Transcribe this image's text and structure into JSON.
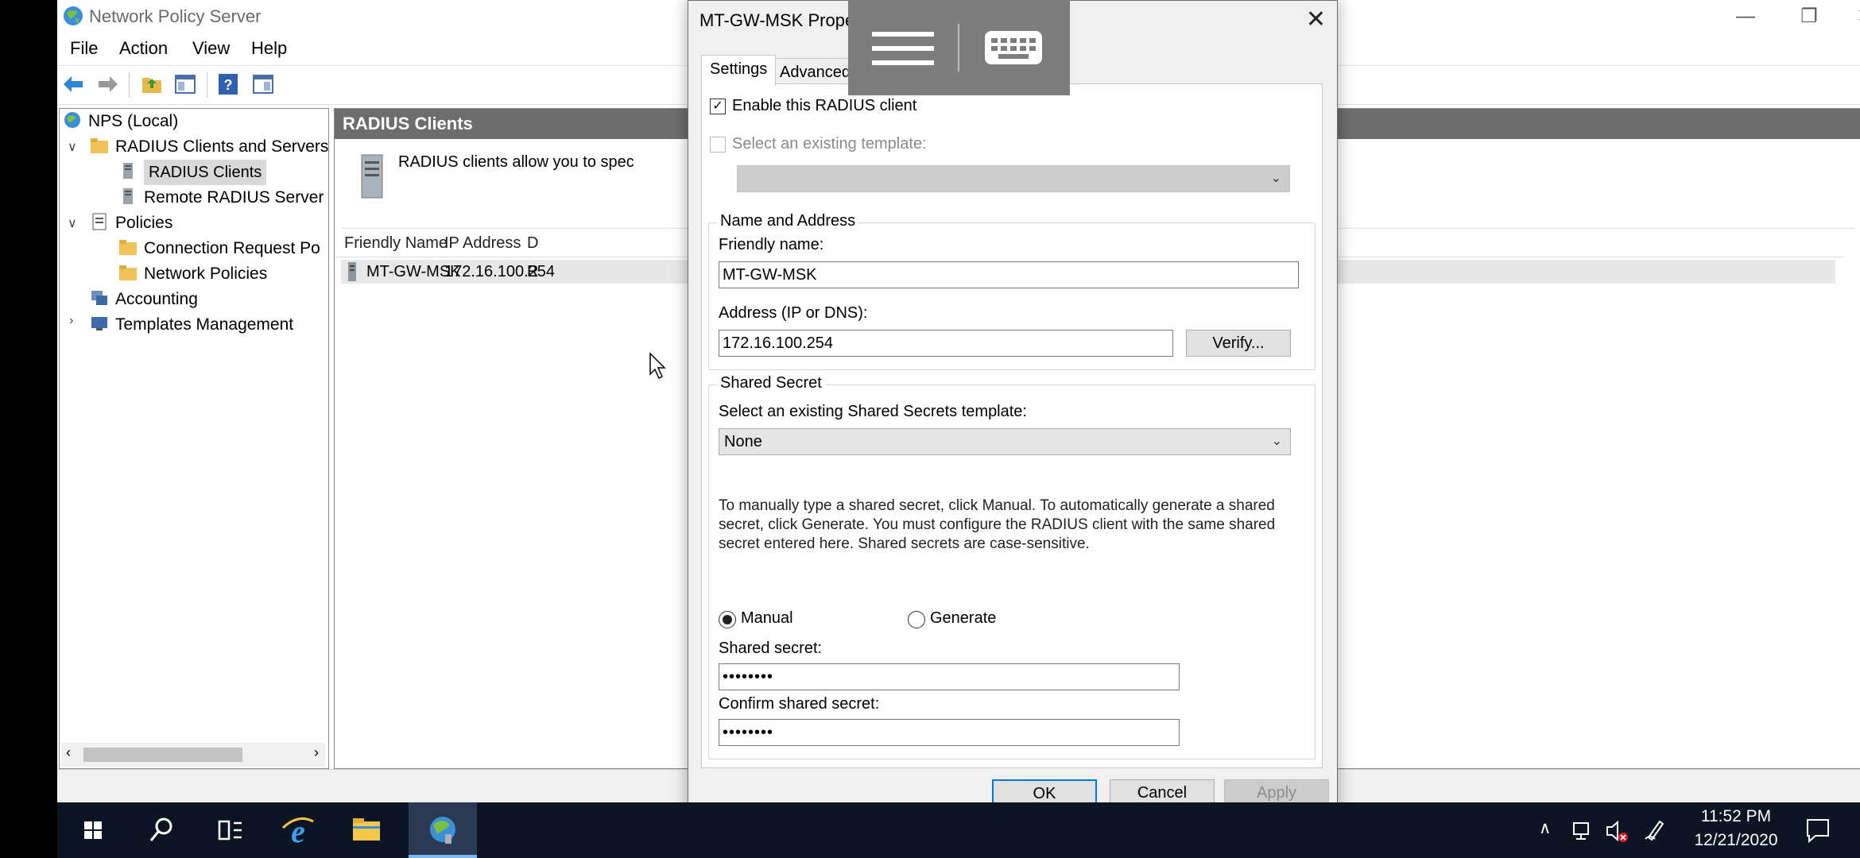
{
  "main_window": {
    "title": "Network Policy Server",
    "menu": [
      "File",
      "Action",
      "View",
      "Help"
    ]
  },
  "tree": {
    "items": [
      {
        "label": "NPS (Local)"
      },
      {
        "label": "RADIUS Clients and Servers"
      },
      {
        "label": "RADIUS Clients"
      },
      {
        "label": "Remote RADIUS Server"
      },
      {
        "label": "Policies"
      },
      {
        "label": "Connection Request Po"
      },
      {
        "label": "Network Policies"
      },
      {
        "label": "Accounting"
      },
      {
        "label": "Templates Management"
      }
    ]
  },
  "content": {
    "header": "RADIUS Clients",
    "description": "RADIUS clients allow you to spec",
    "columns": [
      "Friendly Name",
      "IP Address",
      "D"
    ],
    "rows": [
      {
        "name": "MT-GW-MSK",
        "ip": "172.16.100.254",
        "d": "R"
      }
    ]
  },
  "dialog": {
    "title": "MT-GW-MSK Properties",
    "tabs": [
      "Settings",
      "Advanced"
    ],
    "enable_label": "Enable this RADIUS client",
    "template_label": "Select an existing template:",
    "group_name_address": "Name and Address",
    "friendly_label": "Friendly name:",
    "friendly_value": "MT-GW-MSK",
    "address_label": "Address (IP or DNS):",
    "address_value": "172.16.100.254",
    "verify_button": "Verify...",
    "group_shared_secret": "Shared Secret",
    "ss_template_label": "Select an existing Shared Secrets template:",
    "ss_template_value": "None",
    "instructions": "To manually type a shared secret, click Manual. To automatically generate a shared secret, click Generate. You must configure the RADIUS client with the same shared secret entered here. Shared secrets are case-sensitive.",
    "radio_manual": "Manual",
    "radio_generate": "Generate",
    "secret_label": "Shared secret:",
    "secret_value": "••••••••",
    "confirm_label": "Confirm shared secret:",
    "confirm_value": "••••••••",
    "ok_button": "OK",
    "cancel_button": "Cancel",
    "apply_button": "Apply"
  },
  "taskbar": {
    "time": "11:52 PM",
    "date": "12/21/2020"
  },
  "colors": {
    "pane_header": "#6d6d6d",
    "taskbar": "#0b1524",
    "default_button_border": "#0078d7"
  }
}
